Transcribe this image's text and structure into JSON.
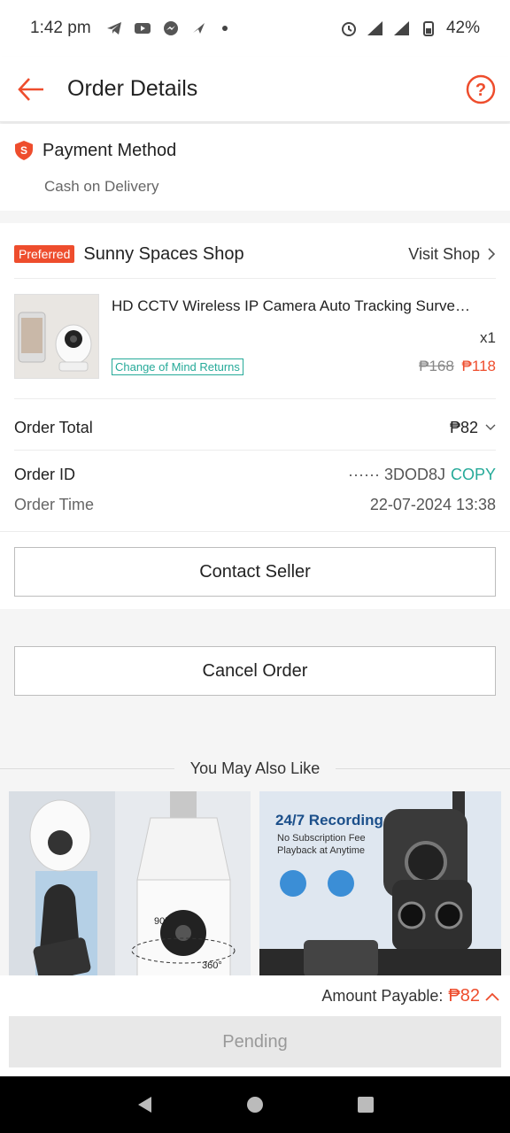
{
  "status_bar": {
    "time": "1:42 pm",
    "battery": "42%",
    "network": "4G"
  },
  "header": {
    "title": "Order Details"
  },
  "payment": {
    "title": "Payment Method",
    "value": "Cash on Delivery"
  },
  "shop": {
    "badge": "Preferred",
    "name": "Sunny Spaces Shop",
    "visit_label": "Visit Shop"
  },
  "product": {
    "name": "HD CCTV Wireless IP Camera Auto Tracking Surve…",
    "qty": "x1",
    "returns_tag": "Change of Mind Returns",
    "old_price": "₱168",
    "new_price": "₱118"
  },
  "order": {
    "total_label": "Order Total",
    "total_value": "₱82",
    "id_label": "Order ID",
    "id_value": "······ 3DOD8J",
    "copy_label": "COPY",
    "time_label": "Order Time",
    "time_value": "22-07-2024 13:38"
  },
  "buttons": {
    "contact_seller": "Contact Seller",
    "cancel_order": "Cancel Order",
    "pending": "Pending"
  },
  "recommendations": {
    "heading": "You May Also Like",
    "item2_headline": "24/7 Recording",
    "item2_sub": "No Subscription Fee",
    "item2_sub2": "Playback at Anytime",
    "item1_angle_a": "90°",
    "item1_angle_b": "360°"
  },
  "footer": {
    "payable_label": "Amount Payable:",
    "payable_value": "₱82"
  },
  "colors": {
    "brand": "#ee4d2d",
    "teal": "#26aa99"
  }
}
